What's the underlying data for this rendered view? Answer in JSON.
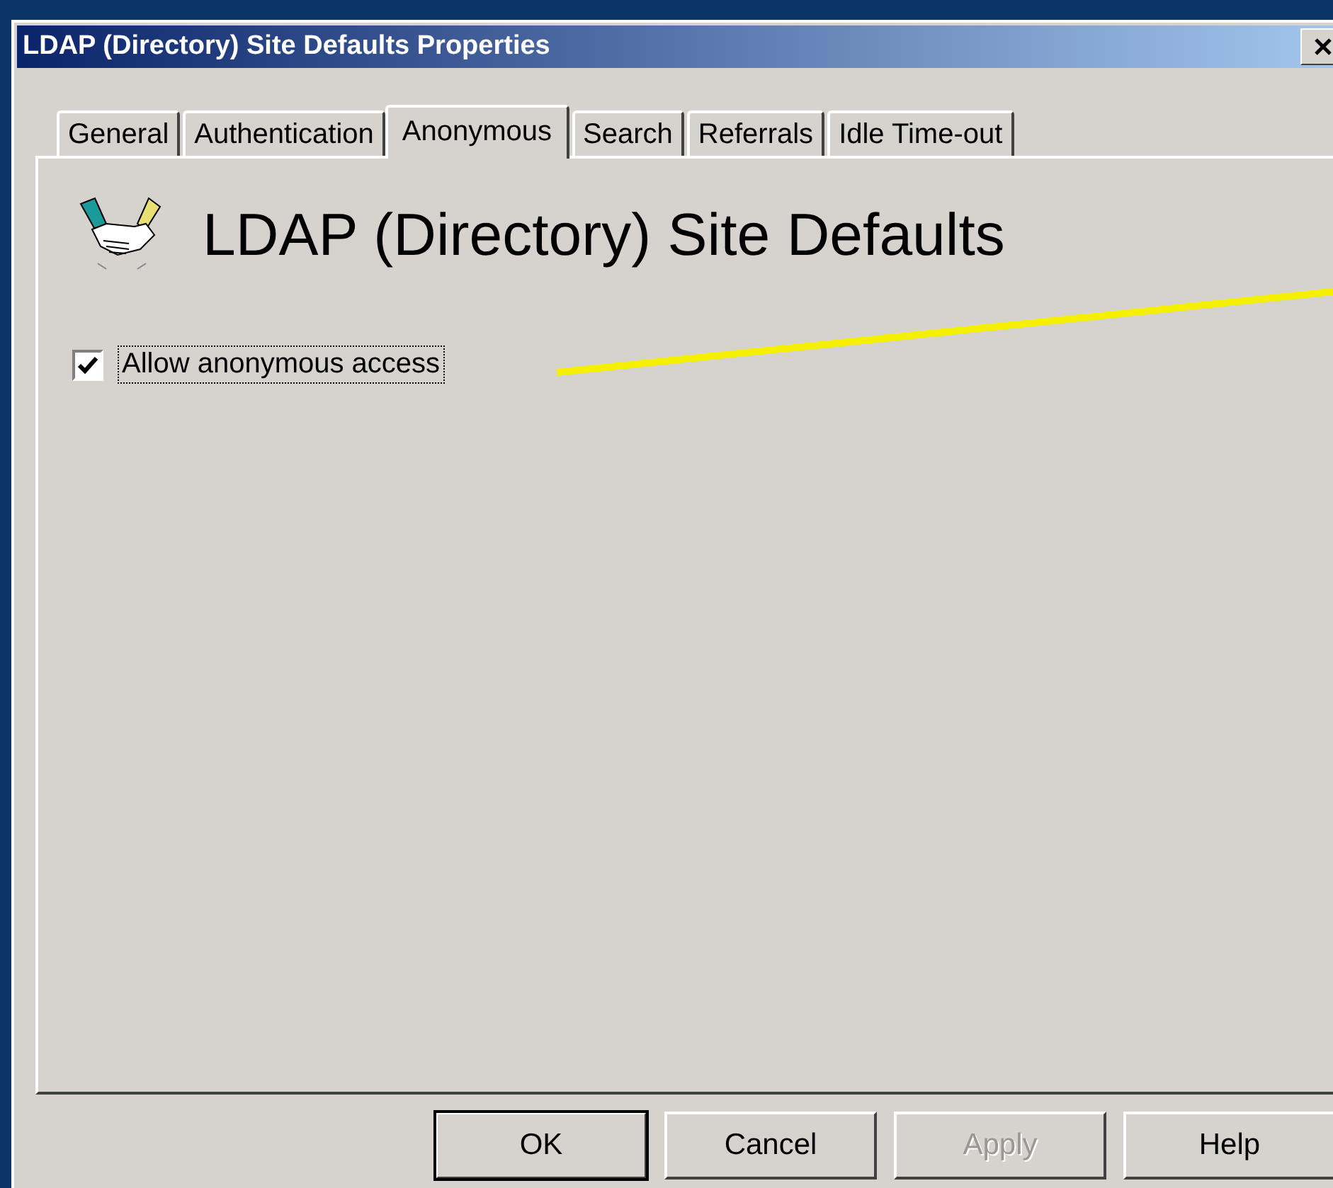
{
  "window": {
    "title": "LDAP (Directory) Site Defaults Properties"
  },
  "tabs": [
    {
      "label": "General",
      "selected": false
    },
    {
      "label": "Authentication",
      "selected": false
    },
    {
      "label": "Anonymous",
      "selected": true
    },
    {
      "label": "Search",
      "selected": false
    },
    {
      "label": "Referrals",
      "selected": false
    },
    {
      "label": "Idle Time-out",
      "selected": false
    }
  ],
  "heading": "LDAP (Directory) Site Defaults",
  "option": {
    "label": "Allow anonymous access",
    "checked": true,
    "focused": true
  },
  "buttons": [
    {
      "label": "OK",
      "default": true,
      "disabled": false
    },
    {
      "label": "Cancel",
      "default": false,
      "disabled": false
    },
    {
      "label": "Apply",
      "default": false,
      "disabled": true
    },
    {
      "label": "Help",
      "default": false,
      "disabled": false
    }
  ]
}
